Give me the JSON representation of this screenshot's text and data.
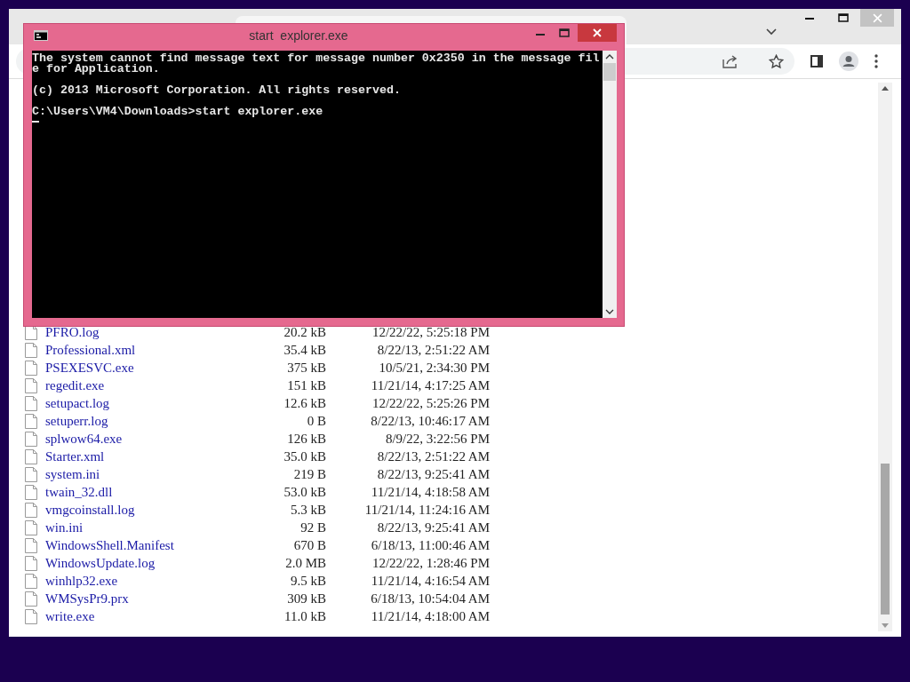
{
  "console": {
    "title": "start  explorer.exe",
    "paragraphs": [
      [
        "The system cannot find message text for message number 0x2350 in the message fil",
        "e for Application."
      ],
      [
        "(c) 2013 Microsoft Corporation. All rights reserved."
      ],
      [
        "C:\\Users\\VM4\\Downloads>start explorer.exe"
      ]
    ]
  },
  "files": [
    {
      "name": "PFRO.log",
      "size": "20.2 kB",
      "modified": "12/22/22, 5:25:18 PM"
    },
    {
      "name": "Professional.xml",
      "size": "35.4 kB",
      "modified": "8/22/13, 2:51:22 AM"
    },
    {
      "name": "PSEXESVC.exe",
      "size": "375 kB",
      "modified": "10/5/21, 2:34:30 PM"
    },
    {
      "name": "regedit.exe",
      "size": "151 kB",
      "modified": "11/21/14, 4:17:25 AM"
    },
    {
      "name": "setupact.log",
      "size": "12.6 kB",
      "modified": "12/22/22, 5:25:26 PM"
    },
    {
      "name": "setuperr.log",
      "size": "0 B",
      "modified": "8/22/13, 10:46:17 AM"
    },
    {
      "name": "splwow64.exe",
      "size": "126 kB",
      "modified": "8/9/22, 3:22:56 PM"
    },
    {
      "name": "Starter.xml",
      "size": "35.0 kB",
      "modified": "8/22/13, 2:51:22 AM"
    },
    {
      "name": "system.ini",
      "size": "219 B",
      "modified": "8/22/13, 9:25:41 AM"
    },
    {
      "name": "twain_32.dll",
      "size": "53.0 kB",
      "modified": "11/21/14, 4:18:58 AM"
    },
    {
      "name": "vmgcoinstall.log",
      "size": "5.3 kB",
      "modified": "11/21/14, 11:24:16 AM"
    },
    {
      "name": "win.ini",
      "size": "92 B",
      "modified": "8/22/13, 9:25:41 AM"
    },
    {
      "name": "WindowsShell.Manifest",
      "size": "670 B",
      "modified": "6/18/13, 11:00:46 AM"
    },
    {
      "name": "WindowsUpdate.log",
      "size": "2.0 MB",
      "modified": "12/22/22, 1:28:46 PM"
    },
    {
      "name": "winhlp32.exe",
      "size": "9.5 kB",
      "modified": "11/21/14, 4:16:54 AM"
    },
    {
      "name": "WMSysPr9.prx",
      "size": "309 kB",
      "modified": "6/18/13, 10:54:04 AM"
    },
    {
      "name": "write.exe",
      "size": "11.0 kB",
      "modified": "11/21/14, 4:18:00 AM"
    }
  ]
}
